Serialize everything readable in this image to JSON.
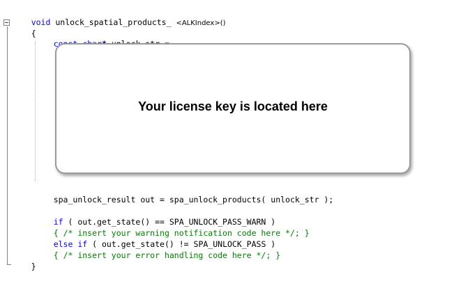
{
  "code": {
    "func_return_type": "void",
    "func_name": "unlock_spatial_products_",
    "func_template": "<ALKIndex>",
    "func_parens": "()",
    "open_brace": "{",
    "decl_kw1": "const",
    "decl_kw2": "char",
    "decl_star": "*",
    "decl_rest": " unlock_str =",
    "result_line": "spa_unlock_result out = spa_unlock_products( unlock_str );",
    "if1_kw": "if",
    "if1_rest": " ( out.get_state() == SPA_UNLOCK_PASS_WARN )",
    "body1_open": "{ ",
    "body1_comment": "/* insert your warning notification code here */",
    "body1_close": "; }",
    "else_kw": "else",
    "if2_kw": "if",
    "if2_rest": " ( out.get_state() != SPA_UNLOCK_PASS )",
    "body2_open": "{ ",
    "body2_comment": "/* insert your error handling code here */",
    "body2_close": "; }",
    "close_brace": "}"
  },
  "callout": {
    "text": "Your license key is located here"
  },
  "icons": {
    "fold": "fold-collapse-icon"
  }
}
